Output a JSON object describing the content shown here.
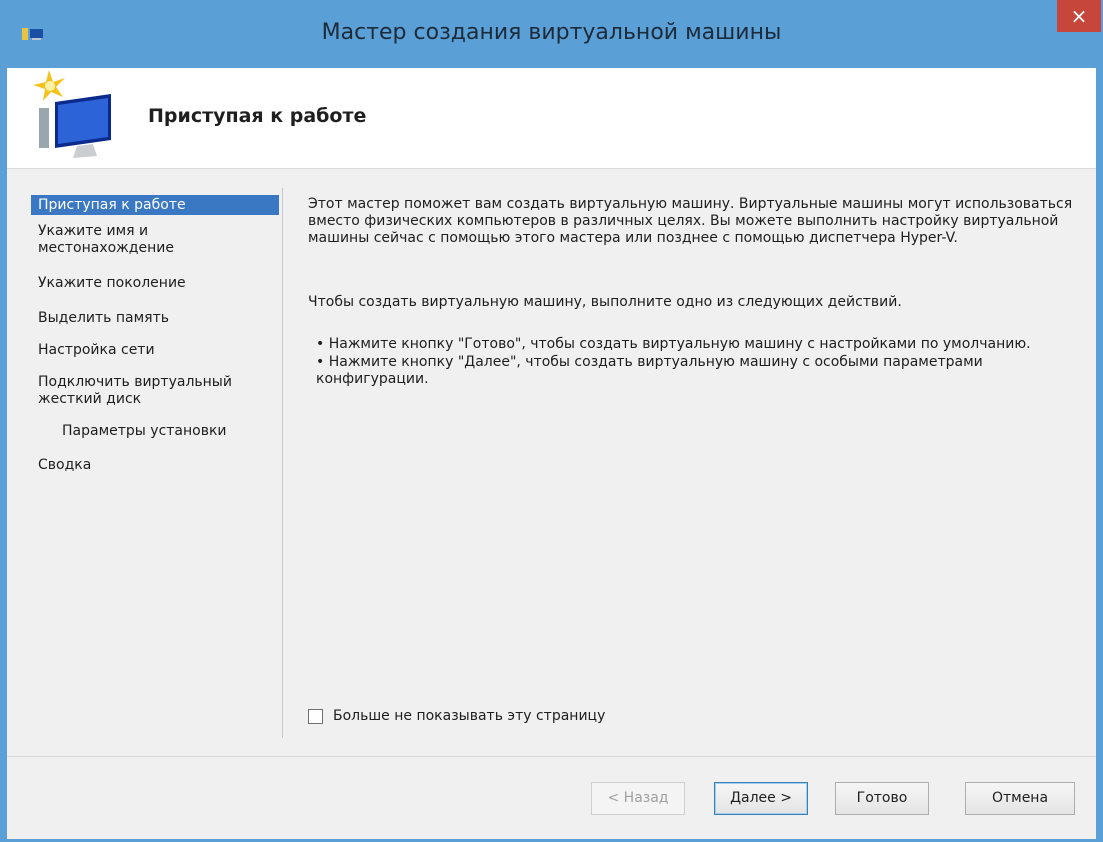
{
  "window": {
    "title": "Мастер создания виртуальной машины",
    "close_glyph": "×"
  },
  "header": {
    "title": "Приступая к работе",
    "icon": "wizard-monitor-star-icon"
  },
  "nav": {
    "items": [
      {
        "label": "Приступая к работе"
      },
      {
        "label": "Укажите имя и\nместонахождение"
      },
      {
        "label": "Укажите поколение"
      },
      {
        "label": "Выделить память"
      },
      {
        "label": "Настройка сети"
      },
      {
        "label": "Подключить виртуальный\nжесткий диск"
      },
      {
        "label": "Параметры установки"
      },
      {
        "label": "Сводка"
      }
    ]
  },
  "content": {
    "intro": "Этот мастер поможет вам создать виртуальную машину. Виртуальные машины могут использоваться вместо физических компьютеров в различных целях. Вы можете выполнить настройку виртуальной машины сейчас с помощью этого мастера или позднее с помощью диспетчера Hyper-V.",
    "instruction": "Чтобы создать виртуальную машину, выполните одно из следующих действий.",
    "bullet1": "• Нажмите кнопку \"Готово\", чтобы создать виртуальную машину с настройками по умолчанию.",
    "bullet2": "• Нажмите кнопку \"Далее\", чтобы создать виртуальную машину с особыми параметрами конфигурации."
  },
  "checkbox": {
    "label": "Больше не показывать эту страницу",
    "checked": false
  },
  "buttons": {
    "back": "< Назад",
    "next": "Далее >",
    "finish": "Готово",
    "cancel": "Отмена"
  },
  "colors": {
    "frame": "#5aa0d6",
    "close": "#c7463c",
    "selection": "#3a78c4"
  }
}
